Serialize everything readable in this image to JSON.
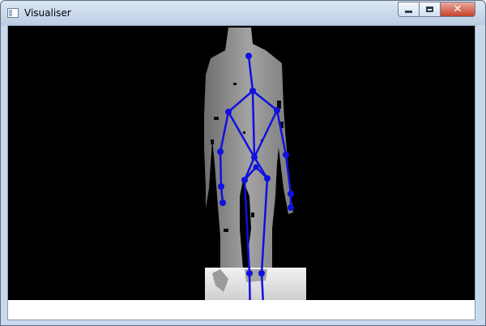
{
  "window": {
    "title": "Visualiser",
    "icon": "app-window-icon",
    "controls": {
      "minimize_icon": "minimize-icon",
      "maximize_icon": "maximize-icon",
      "close_icon": "close-icon",
      "close_glyph": "✕"
    }
  },
  "viewport": {
    "background_color": "#000000",
    "depth_silhouette_color": "#8c8c8c",
    "skeleton_color": "#1010e0"
  }
}
